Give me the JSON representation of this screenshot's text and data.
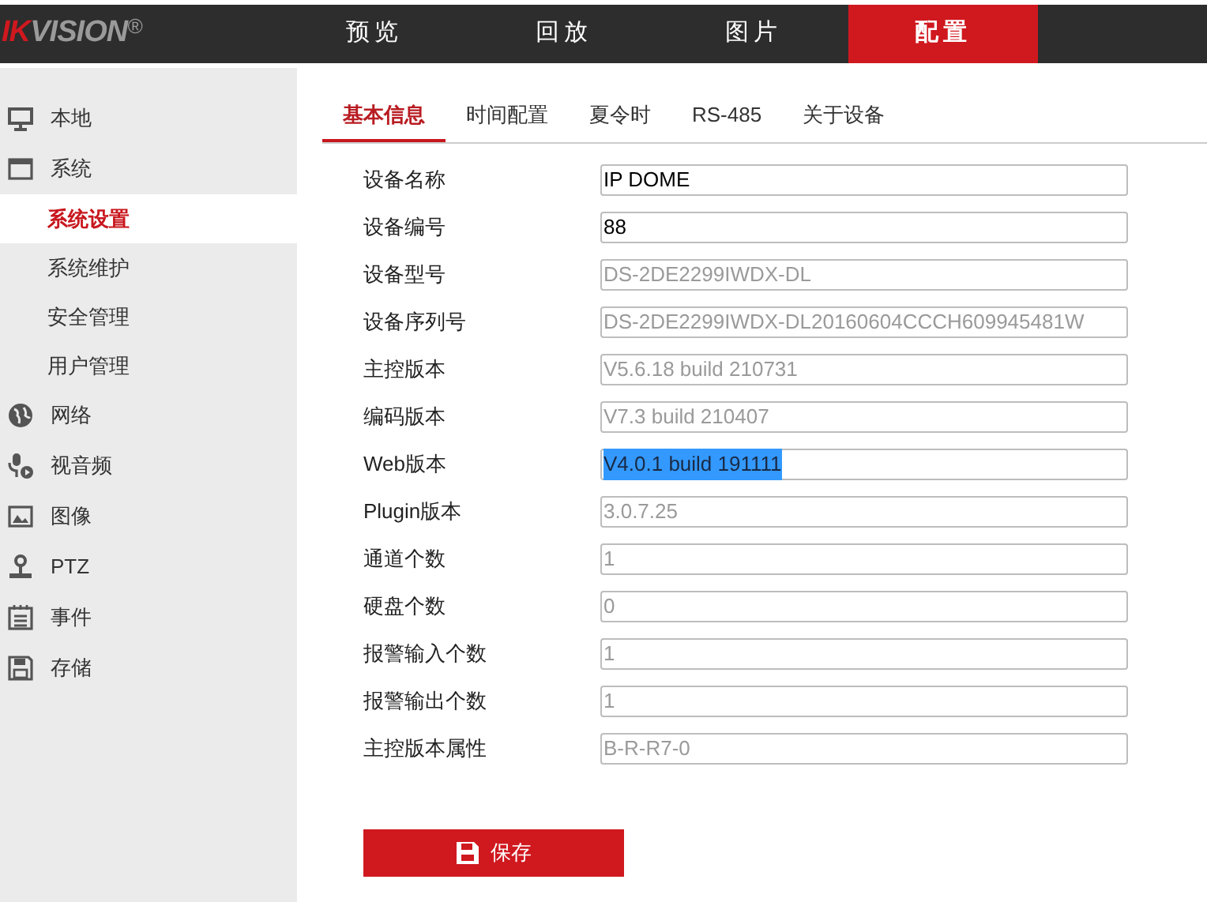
{
  "logo": {
    "accent": "IK",
    "text": "VISION",
    "mark": "®"
  },
  "nav": [
    {
      "label": "预览",
      "selected": false
    },
    {
      "label": "回放",
      "selected": false
    },
    {
      "label": "图片",
      "selected": false
    },
    {
      "label": "配置",
      "selected": true
    }
  ],
  "sidebar": {
    "items": [
      {
        "label": "本地",
        "selected": false
      },
      {
        "label": "系统",
        "selected": false,
        "children": [
          {
            "label": "系统设置",
            "selected": true
          },
          {
            "label": "系统维护",
            "selected": false
          },
          {
            "label": "安全管理",
            "selected": false
          },
          {
            "label": "用户管理",
            "selected": false
          }
        ]
      },
      {
        "label": "网络",
        "selected": false
      },
      {
        "label": "视音频",
        "selected": false
      },
      {
        "label": "图像",
        "selected": false
      },
      {
        "label": "PTZ",
        "selected": false
      },
      {
        "label": "事件",
        "selected": false
      },
      {
        "label": "存储",
        "selected": false
      }
    ]
  },
  "tabs": [
    {
      "label": "基本信息",
      "selected": true
    },
    {
      "label": "时间配置",
      "selected": false
    },
    {
      "label": "夏令时",
      "selected": false
    },
    {
      "label": "RS-485",
      "selected": false
    },
    {
      "label": "关于设备",
      "selected": false
    }
  ],
  "form": [
    {
      "label": "设备名称",
      "value": "IP DOME",
      "disabled": false,
      "highlighted": false
    },
    {
      "label": "设备编号",
      "value": "88",
      "disabled": false,
      "highlighted": false
    },
    {
      "label": "设备型号",
      "value": "DS-2DE2299IWDX-DL",
      "disabled": true,
      "highlighted": false
    },
    {
      "label": "设备序列号",
      "value": "DS-2DE2299IWDX-DL20160604CCCH609945481W",
      "disabled": true,
      "highlighted": false
    },
    {
      "label": "主控版本",
      "value": "V5.6.18 build 210731",
      "disabled": true,
      "highlighted": false
    },
    {
      "label": "编码版本",
      "value": "V7.3 build 210407",
      "disabled": true,
      "highlighted": false
    },
    {
      "label": "Web版本",
      "value": "V4.0.1 build 191111",
      "disabled": true,
      "highlighted": true
    },
    {
      "label": "Plugin版本",
      "value": "3.0.7.25",
      "disabled": true,
      "highlighted": false
    },
    {
      "label": "通道个数",
      "value": "1",
      "disabled": true,
      "highlighted": false
    },
    {
      "label": "硬盘个数",
      "value": "0",
      "disabled": true,
      "highlighted": false
    },
    {
      "label": "报警输入个数",
      "value": "1",
      "disabled": true,
      "highlighted": false
    },
    {
      "label": "报警输出个数",
      "value": "1",
      "disabled": true,
      "highlighted": false
    },
    {
      "label": "主控版本属性",
      "value": "B-R-R7-0",
      "disabled": true,
      "highlighted": false
    }
  ],
  "save_button": {
    "label": "保存"
  }
}
